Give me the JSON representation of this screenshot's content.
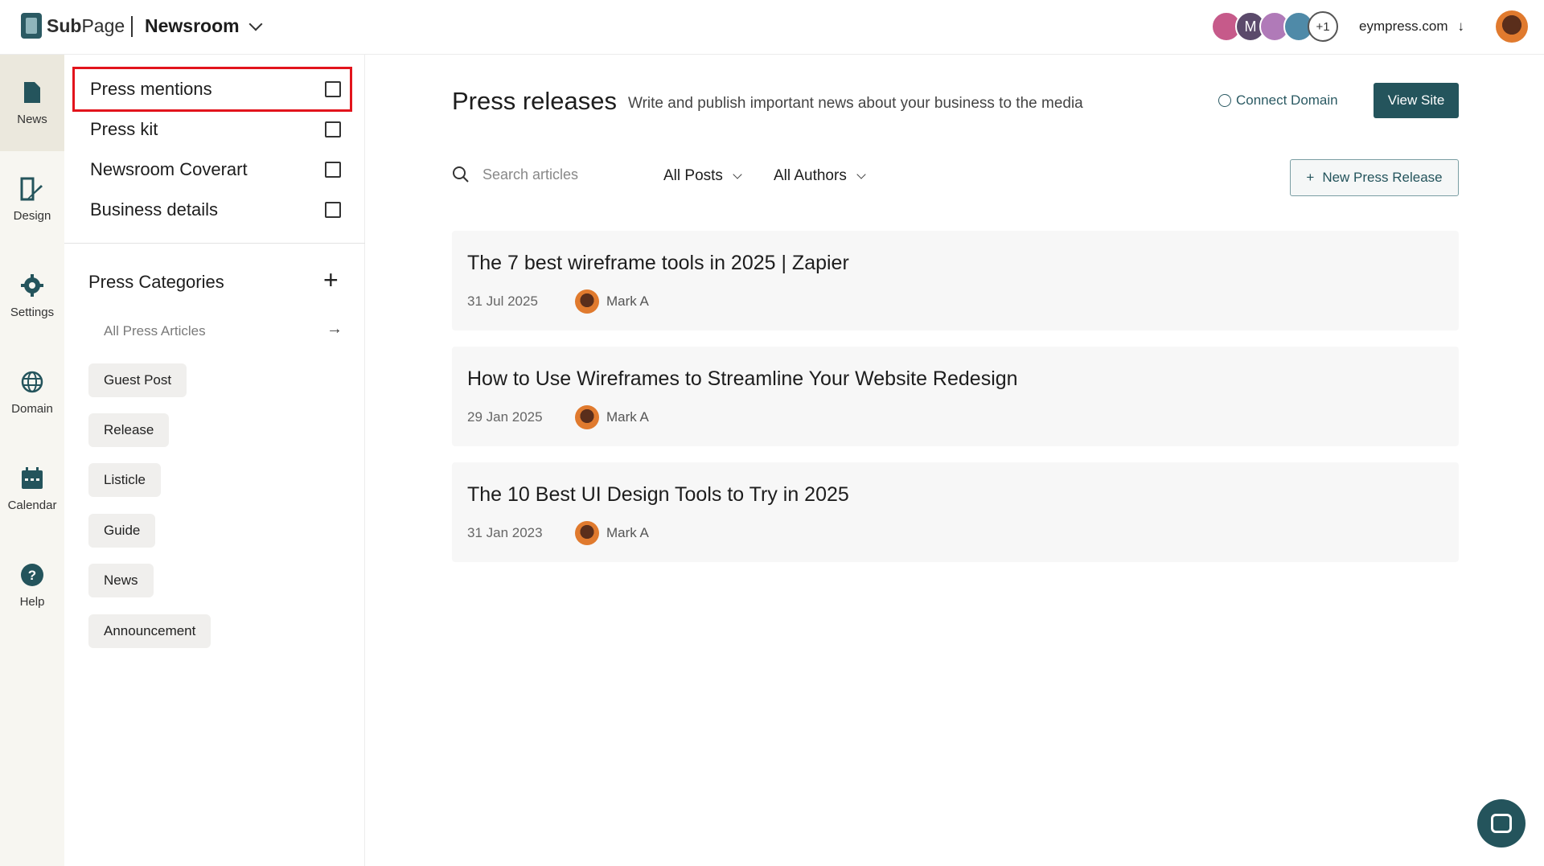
{
  "brand": {
    "name_bold": "Sub",
    "name_rest": "Page"
  },
  "workspace": "Newsroom",
  "header": {
    "avatar_more": "+1",
    "avatar_letter": "M",
    "domain": "eympress.com",
    "domain_arrow": "↓"
  },
  "rail": [
    {
      "label": "News",
      "icon": "document-icon"
    },
    {
      "label": "Design",
      "icon": "design-icon"
    },
    {
      "label": "Settings",
      "icon": "gear-icon"
    },
    {
      "label": "Domain",
      "icon": "globe-icon"
    },
    {
      "label": "Calendar",
      "icon": "calendar-icon"
    },
    {
      "label": "Help",
      "icon": "help-icon"
    }
  ],
  "panel": {
    "menu": [
      {
        "label": "Press mentions",
        "icon": "newspaper-icon"
      },
      {
        "label": "Press kit",
        "icon": "kit-icon"
      },
      {
        "label": "Newsroom Coverart",
        "icon": "image-icon"
      },
      {
        "label": "Business details",
        "icon": "briefcase-icon"
      }
    ],
    "categories_title": "Press Categories",
    "add_symbol": "+",
    "all_articles": "All Press Articles",
    "all_arrow": "→",
    "chips": [
      "Guest Post",
      "Release",
      "Listicle",
      "Guide",
      "News",
      "Announcement"
    ]
  },
  "main": {
    "title": "Press releases",
    "subtitle": "Write and publish important news about your business to the media",
    "connect_domain": "Connect Domain",
    "view_site": "View Site",
    "search_placeholder": "Search articles",
    "filter_posts": "All Posts",
    "filter_authors": "All Authors",
    "new_button": "New Press Release",
    "new_plus": "+",
    "articles": [
      {
        "title": "The 7 best wireframe tools in 2025 | Zapier",
        "date": "31 Jul 2025",
        "author": "Mark A"
      },
      {
        "title": "How to Use Wireframes to Streamline Your Website Redesign",
        "date": "29 Jan 2025",
        "author": "Mark A"
      },
      {
        "title": "The 10 Best UI Design Tools to Try in 2025",
        "date": "31 Jan 2023",
        "author": "Mark A"
      }
    ]
  },
  "colors": {
    "accent": "#24545c",
    "highlight": "#e2141c",
    "rail_bg": "#f7f6f1"
  }
}
